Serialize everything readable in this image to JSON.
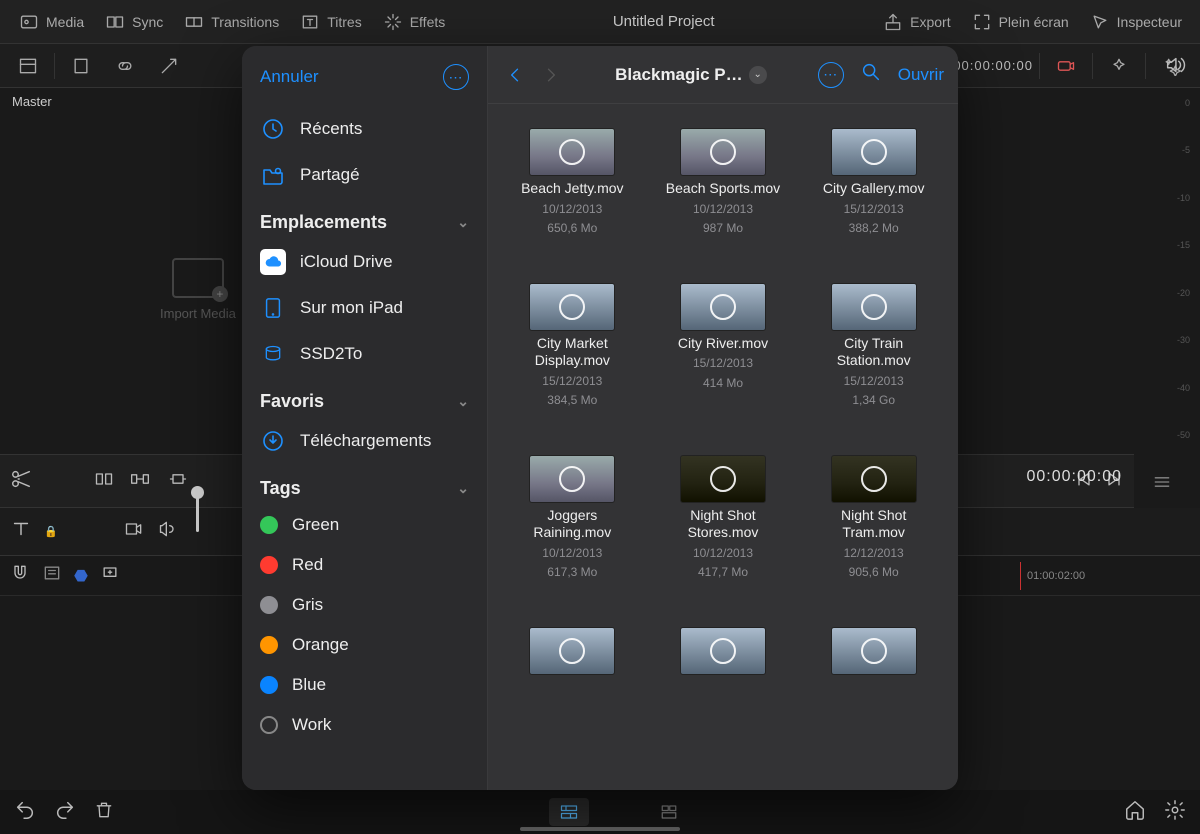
{
  "toolbar": {
    "media": "Media",
    "sync": "Sync",
    "transitions": "Transitions",
    "titres": "Titres",
    "effets": "Effets",
    "project_title": "Untitled Project",
    "export": "Export",
    "plein_ecran": "Plein écran",
    "inspecteur": "Inspecteur"
  },
  "sec": {
    "timecode": "00:00:00:00"
  },
  "master": {
    "label": "Master"
  },
  "bg": {
    "import_label": "Import Media"
  },
  "meter": {
    "ticks": [
      "0",
      "-5",
      "-10",
      "-15",
      "-20",
      "-30",
      "-40",
      "-50"
    ]
  },
  "transport": {
    "timecode": "00:00:00:00"
  },
  "timeline": {
    "marker": "01:00:02:00"
  },
  "modal": {
    "sidebar": {
      "cancel": "Annuler",
      "recents": "Récents",
      "shared": "Partagé",
      "locations_header": "Emplacements",
      "favorites_header": "Favoris",
      "tags_header": "Tags",
      "locations": {
        "icloud": "iCloud Drive",
        "ipad": "Sur mon iPad",
        "ssd": "SSD2To"
      },
      "favorites": {
        "downloads": "Téléchargements"
      },
      "tags": {
        "green": "Green",
        "red": "Red",
        "gris": "Gris",
        "orange": "Orange",
        "blue": "Blue",
        "work": "Work"
      }
    },
    "header": {
      "title": "Blackmagic P…",
      "open": "Ouvrir"
    },
    "files": [
      {
        "name": "Beach Jetty.mov",
        "date": "10/12/2013",
        "size": "650,6 Mo",
        "style": ""
      },
      {
        "name": "Beach Sports.mov",
        "date": "10/12/2013",
        "size": "987 Mo",
        "style": ""
      },
      {
        "name": "City Gallery.mov",
        "date": "15/12/2013",
        "size": "388,2 Mo",
        "style": "city"
      },
      {
        "name": "City Market Display.mov",
        "date": "15/12/2013",
        "size": "384,5 Mo",
        "style": "city"
      },
      {
        "name": "City River.mov",
        "date": "15/12/2013",
        "size": "414 Mo",
        "style": "city"
      },
      {
        "name": "City Train Station.mov",
        "date": "15/12/2013",
        "size": "1,34 Go",
        "style": "city"
      },
      {
        "name": "Joggers Raining.mov",
        "date": "10/12/2013",
        "size": "617,3 Mo",
        "style": ""
      },
      {
        "name": "Night Shot Stores.mov",
        "date": "10/12/2013",
        "size": "417,7 Mo",
        "style": "night"
      },
      {
        "name": "Night Shot Tram.mov",
        "date": "12/12/2013",
        "size": "905,6 Mo",
        "style": "night"
      },
      {
        "name": "",
        "date": "",
        "size": "",
        "style": "city"
      },
      {
        "name": "",
        "date": "",
        "size": "",
        "style": "city"
      },
      {
        "name": "",
        "date": "",
        "size": "",
        "style": "city"
      }
    ]
  },
  "colors": {
    "accent": "#1e90ff",
    "tag_green": "#34c759",
    "tag_red": "#ff3b30",
    "tag_gris": "#8e8e93",
    "tag_orange": "#ff9500",
    "tag_blue": "#0a84ff"
  }
}
